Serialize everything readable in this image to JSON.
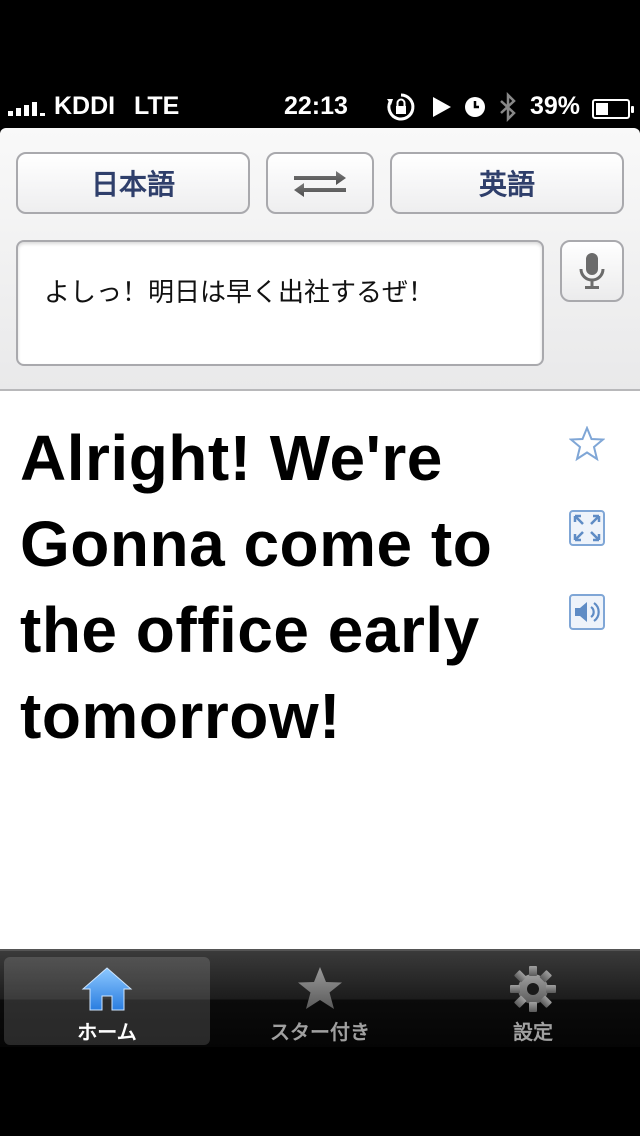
{
  "status_bar": {
    "carrier": "KDDI",
    "network": "LTE",
    "time": "22:13",
    "battery_percent": "39%",
    "battery_level": 0.39,
    "icons": [
      "signal-icon",
      "rotation-lock-icon",
      "play-icon",
      "alarm-icon",
      "bluetooth-icon",
      "battery-icon"
    ]
  },
  "translator": {
    "source_language": "日本語",
    "target_language": "英語",
    "swap_icon": "swap-arrows-icon",
    "mic_icon": "microphone-icon",
    "input_text": "よしっ！明日は早く出社するぜ！",
    "output_text": "Alright! We're Gonna come to the office early tomorrow!",
    "side_icons": [
      "star-icon",
      "fullscreen-icon",
      "speaker-icon"
    ]
  },
  "tabbar": {
    "tabs": [
      {
        "label": "ホーム",
        "icon": "home-icon",
        "active": true
      },
      {
        "label": "スター付き",
        "icon": "star-icon",
        "active": false
      },
      {
        "label": "設定",
        "icon": "gear-icon",
        "active": false
      }
    ]
  },
  "colors": {
    "accent_text": "#2f3f6b",
    "icon_blue": "#7fa6d6",
    "tab_active_icon": "#4a9af0"
  }
}
